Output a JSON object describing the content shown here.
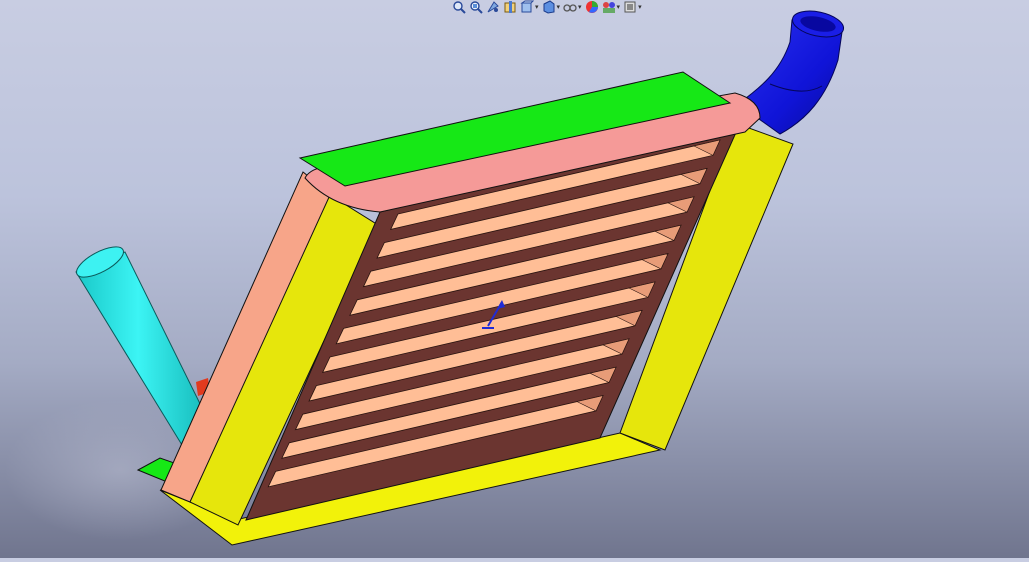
{
  "window": {
    "kind": "3D CAD viewport"
  },
  "colors": {
    "background_top": "#c8cde2",
    "background_bottom": "#70758e",
    "frame_yellow": "#e6e60c",
    "side_plate_salmon": "#f7a589",
    "top_plate_pink": "#f59a98",
    "top_cover_green": "#16e816",
    "core_dark": "#6b3530",
    "fin_peach": "#ffbe96",
    "inlet_pipe_cyan": "#22e8e8",
    "outlet_pipe_blue": "#1014d8",
    "axis_blue": "#1f2bd6"
  },
  "toolbar": {
    "items": [
      {
        "name": "zoom-to-fit-icon",
        "has_dropdown": false
      },
      {
        "name": "zoom-to-area-icon",
        "has_dropdown": false
      },
      {
        "name": "previous-view-icon",
        "has_dropdown": false
      },
      {
        "name": "section-view-icon",
        "has_dropdown": false
      },
      {
        "name": "view-orientation-icon",
        "has_dropdown": true
      },
      {
        "name": "display-style-icon",
        "has_dropdown": true
      },
      {
        "name": "hide-show-items-icon",
        "has_dropdown": true
      },
      {
        "name": "edit-appearance-icon",
        "has_dropdown": false
      },
      {
        "name": "apply-scene-icon",
        "has_dropdown": true
      },
      {
        "name": "view-settings-icon",
        "has_dropdown": true
      }
    ]
  },
  "model": {
    "parts": [
      "frame-bottom",
      "frame-right",
      "frame-left",
      "side-plate-left",
      "top-plate",
      "top-cover",
      "radiator-core",
      "fins",
      "inlet-pipe",
      "outlet-pipe",
      "bottom-tab"
    ],
    "fin_count": 10
  }
}
